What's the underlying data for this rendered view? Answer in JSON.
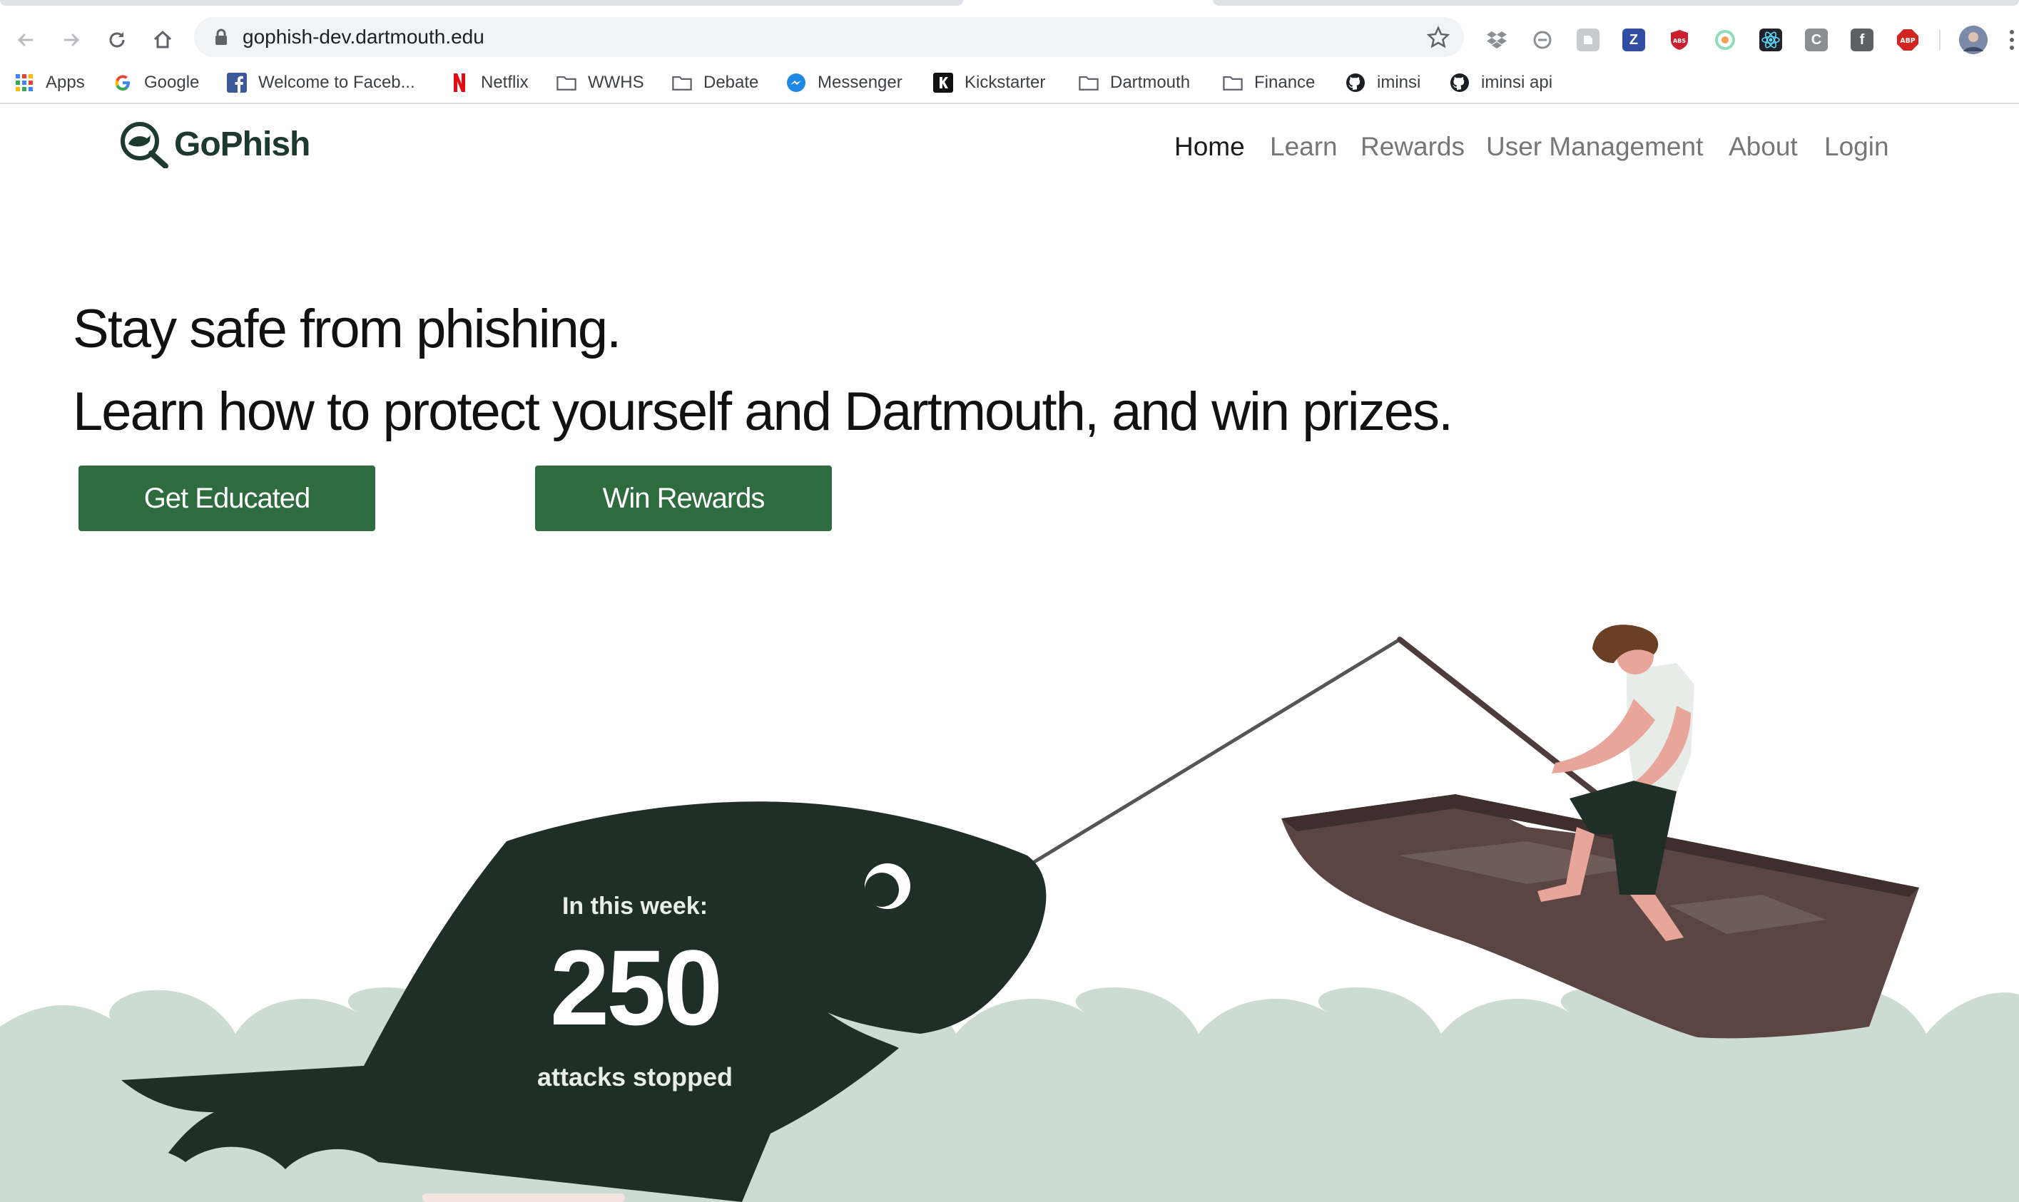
{
  "browser": {
    "url": "gophish-dev.dartmouth.edu",
    "bookmarks": [
      {
        "label": "Apps",
        "icon": "apps-grid-icon"
      },
      {
        "label": "Google",
        "icon": "google-icon"
      },
      {
        "label": "Welcome to Faceb...",
        "icon": "facebook-icon"
      },
      {
        "label": "Netflix",
        "icon": "netflix-icon"
      },
      {
        "label": "WWHS",
        "icon": "folder-icon"
      },
      {
        "label": "Debate",
        "icon": "folder-icon"
      },
      {
        "label": "Messenger",
        "icon": "messenger-icon"
      },
      {
        "label": "Kickstarter",
        "icon": "kickstarter-icon"
      },
      {
        "label": "Dartmouth",
        "icon": "folder-icon"
      },
      {
        "label": "Finance",
        "icon": "folder-icon"
      },
      {
        "label": "iminsi",
        "icon": "github-icon"
      },
      {
        "label": "iminsi api",
        "icon": "github-icon"
      }
    ],
    "extensions": {
      "z": "Z",
      "c": "C",
      "f": "f",
      "abp": "ABP",
      "abs": "ABS"
    }
  },
  "site": {
    "brand": "GoPhish",
    "nav": [
      "Home",
      "Learn",
      "Rewards",
      "User Management",
      "About",
      "Login"
    ],
    "active_nav": "Home",
    "hero_line1": "Stay safe from phishing.",
    "hero_line2": "Learn how to protect yourself and Dartmouth, and win prizes.",
    "cta_educated": "Get Educated",
    "cta_rewards": "Win Rewards",
    "stat_label": "In this week:",
    "stat_value": "250",
    "stat_caption": "attacks stopped"
  },
  "colors": {
    "brand_green": "#2e6b3f",
    "fish": "#1f2f28",
    "water": "#ccdcd3",
    "boat": "#5a4542"
  }
}
